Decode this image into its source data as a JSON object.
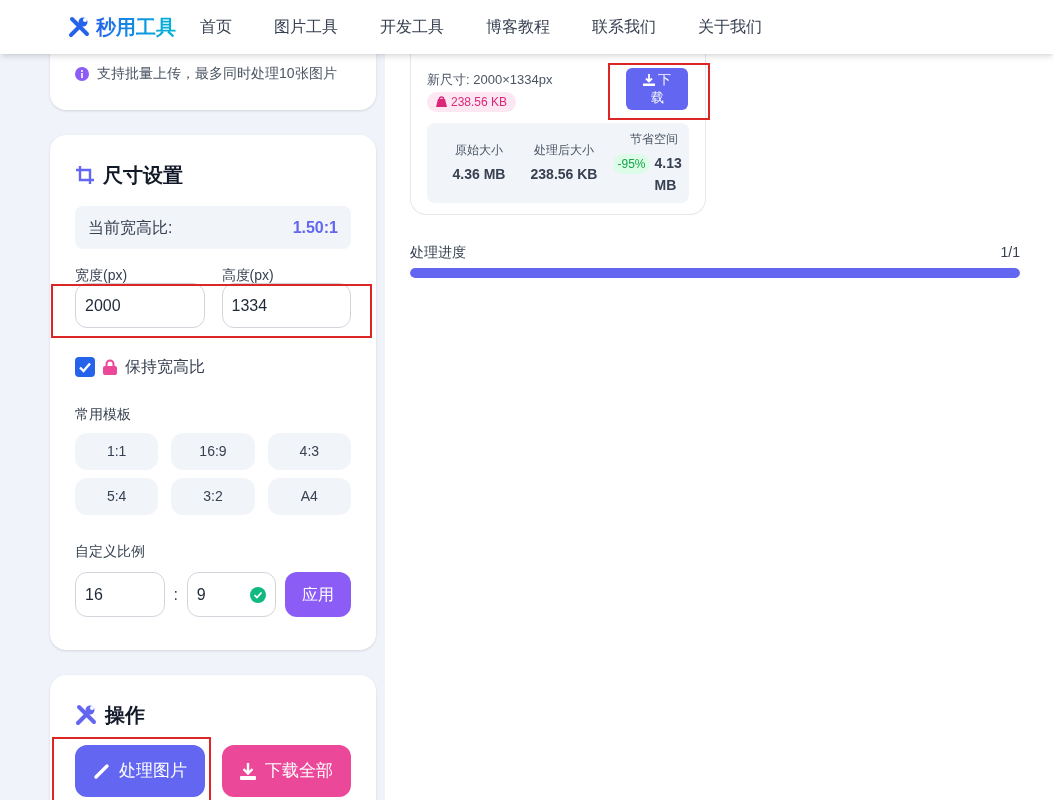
{
  "header": {
    "logo": "秒用工具",
    "nav": [
      "首页",
      "图片工具",
      "开发工具",
      "博客教程",
      "联系我们",
      "关于我们"
    ]
  },
  "upload_note": "支持批量上传，最多同时处理10张图片",
  "size_settings": {
    "title": "尺寸设置",
    "ratio_label": "当前宽高比:",
    "ratio_value": "1.50:1",
    "dimensions": {
      "annotated": true,
      "width_label": "宽度(px)",
      "width_value": "2000",
      "height_label": "高度(px)",
      "height_value": "1334"
    },
    "keep_ratio": {
      "label": "保持宽高比",
      "checked": true
    },
    "templates_label": "常用模板",
    "templates": [
      "1:1",
      "16:9",
      "4:3",
      "5:4",
      "3:2",
      "A4"
    ],
    "custom_label": "自定义比例",
    "custom_w": "16",
    "separator": ":",
    "custom_h": "9",
    "custom_valid": true,
    "apply": "应用"
  },
  "actions": {
    "title": "操作",
    "buttons": [
      {
        "label": "处理图片",
        "kind": "process",
        "annotated": true
      },
      {
        "label": "下载全部",
        "kind": "download"
      }
    ]
  },
  "result": {
    "new_size": "新尺寸: 2000×1334px",
    "file_size": "238.56 KB",
    "download": {
      "label": "下载",
      "annotated": true
    },
    "stats": [
      {
        "label": "原始大小",
        "value": "4.36 MB"
      },
      {
        "label": "处理后大小",
        "value": "238.56 KB"
      },
      {
        "label": "节省空间",
        "badge": "-95%",
        "value": "4.13 MB"
      }
    ]
  },
  "progress": {
    "label": "处理进度",
    "count": "1/1",
    "level": 1
  }
}
